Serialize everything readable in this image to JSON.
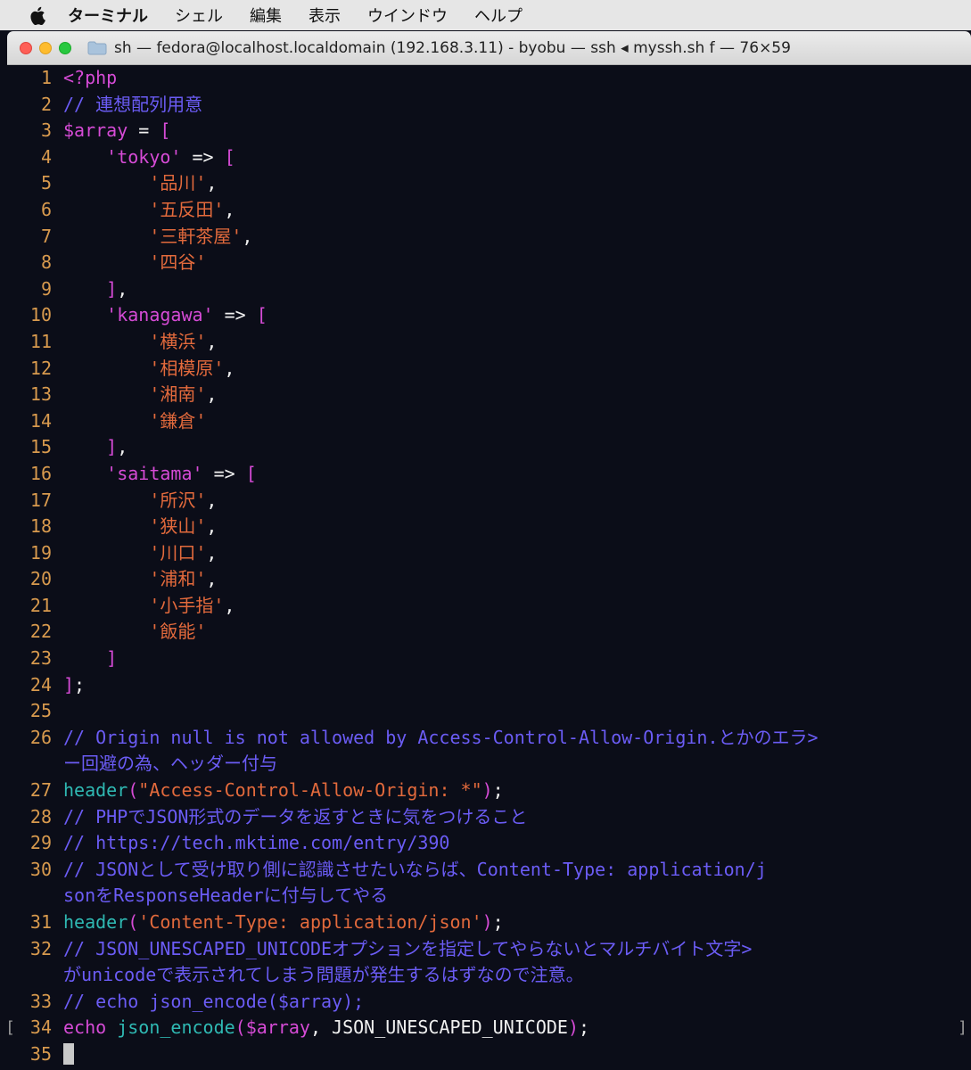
{
  "menubar": {
    "items": [
      "ターミナル",
      "シェル",
      "編集",
      "表示",
      "ウインドウ",
      "ヘルプ"
    ]
  },
  "window": {
    "title": "sh — fedora@localhost.localdomain (192.168.3.11) - byobu — ssh ◂ myssh.sh f — 76×59"
  },
  "colors": {
    "line_number": "#d89a4e",
    "keyword": "#d64bd6",
    "comment": "#6b5cf5",
    "string": "#e36a3c",
    "plain": "#f0f0f0",
    "function": "#2fb9b3",
    "background": "#0b0d18"
  },
  "code_lines": [
    {
      "n": "1",
      "tokens": [
        {
          "t": "<?php",
          "c": "magenta"
        }
      ]
    },
    {
      "n": "2",
      "tokens": [
        {
          "t": "// 連想配列用意",
          "c": "comment"
        }
      ]
    },
    {
      "n": "3",
      "tokens": [
        {
          "t": "$array",
          "c": "magenta"
        },
        {
          "t": " = ",
          "c": "white"
        },
        {
          "t": "[",
          "c": "magenta"
        }
      ]
    },
    {
      "n": "4",
      "tokens": [
        {
          "t": "    ",
          "c": "white"
        },
        {
          "t": "'tokyo'",
          "c": "magenta"
        },
        {
          "t": " => ",
          "c": "white"
        },
        {
          "t": "[",
          "c": "magenta"
        }
      ]
    },
    {
      "n": "5",
      "tokens": [
        {
          "t": "        ",
          "c": "white"
        },
        {
          "t": "'品川'",
          "c": "string"
        },
        {
          "t": ",",
          "c": "white"
        }
      ]
    },
    {
      "n": "6",
      "tokens": [
        {
          "t": "        ",
          "c": "white"
        },
        {
          "t": "'五反田'",
          "c": "string"
        },
        {
          "t": ",",
          "c": "white"
        }
      ]
    },
    {
      "n": "7",
      "tokens": [
        {
          "t": "        ",
          "c": "white"
        },
        {
          "t": "'三軒茶屋'",
          "c": "string"
        },
        {
          "t": ",",
          "c": "white"
        }
      ]
    },
    {
      "n": "8",
      "tokens": [
        {
          "t": "        ",
          "c": "white"
        },
        {
          "t": "'四谷'",
          "c": "string"
        }
      ]
    },
    {
      "n": "9",
      "tokens": [
        {
          "t": "    ",
          "c": "white"
        },
        {
          "t": "]",
          "c": "magenta"
        },
        {
          "t": ",",
          "c": "white"
        }
      ]
    },
    {
      "n": "10",
      "tokens": [
        {
          "t": "    ",
          "c": "white"
        },
        {
          "t": "'kanagawa'",
          "c": "magenta"
        },
        {
          "t": " => ",
          "c": "white"
        },
        {
          "t": "[",
          "c": "magenta"
        }
      ]
    },
    {
      "n": "11",
      "tokens": [
        {
          "t": "        ",
          "c": "white"
        },
        {
          "t": "'横浜'",
          "c": "string"
        },
        {
          "t": ",",
          "c": "white"
        }
      ]
    },
    {
      "n": "12",
      "tokens": [
        {
          "t": "        ",
          "c": "white"
        },
        {
          "t": "'相模原'",
          "c": "string"
        },
        {
          "t": ",",
          "c": "white"
        }
      ]
    },
    {
      "n": "13",
      "tokens": [
        {
          "t": "        ",
          "c": "white"
        },
        {
          "t": "'湘南'",
          "c": "string"
        },
        {
          "t": ",",
          "c": "white"
        }
      ]
    },
    {
      "n": "14",
      "tokens": [
        {
          "t": "        ",
          "c": "white"
        },
        {
          "t": "'鎌倉'",
          "c": "string"
        }
      ]
    },
    {
      "n": "15",
      "tokens": [
        {
          "t": "    ",
          "c": "white"
        },
        {
          "t": "]",
          "c": "magenta"
        },
        {
          "t": ",",
          "c": "white"
        }
      ]
    },
    {
      "n": "16",
      "tokens": [
        {
          "t": "    ",
          "c": "white"
        },
        {
          "t": "'saitama'",
          "c": "magenta"
        },
        {
          "t": " => ",
          "c": "white"
        },
        {
          "t": "[",
          "c": "magenta"
        }
      ]
    },
    {
      "n": "17",
      "tokens": [
        {
          "t": "        ",
          "c": "white"
        },
        {
          "t": "'所沢'",
          "c": "string"
        },
        {
          "t": ",",
          "c": "white"
        }
      ]
    },
    {
      "n": "18",
      "tokens": [
        {
          "t": "        ",
          "c": "white"
        },
        {
          "t": "'狭山'",
          "c": "string"
        },
        {
          "t": ",",
          "c": "white"
        }
      ]
    },
    {
      "n": "19",
      "tokens": [
        {
          "t": "        ",
          "c": "white"
        },
        {
          "t": "'川口'",
          "c": "string"
        },
        {
          "t": ",",
          "c": "white"
        }
      ]
    },
    {
      "n": "20",
      "tokens": [
        {
          "t": "        ",
          "c": "white"
        },
        {
          "t": "'浦和'",
          "c": "string"
        },
        {
          "t": ",",
          "c": "white"
        }
      ]
    },
    {
      "n": "21",
      "tokens": [
        {
          "t": "        ",
          "c": "white"
        },
        {
          "t": "'小手指'",
          "c": "string"
        },
        {
          "t": ",",
          "c": "white"
        }
      ]
    },
    {
      "n": "22",
      "tokens": [
        {
          "t": "        ",
          "c": "white"
        },
        {
          "t": "'飯能'",
          "c": "string"
        }
      ]
    },
    {
      "n": "23",
      "tokens": [
        {
          "t": "    ",
          "c": "white"
        },
        {
          "t": "]",
          "c": "magenta"
        }
      ]
    },
    {
      "n": "24",
      "tokens": [
        {
          "t": "]",
          "c": "magenta"
        },
        {
          "t": ";",
          "c": "white"
        }
      ]
    },
    {
      "n": "25",
      "tokens": []
    },
    {
      "n": "26",
      "tokens": [
        {
          "t": "// Origin null is not allowed by Access-Control-Allow-Origin.とかのエラ>",
          "c": "comment"
        }
      ]
    },
    {
      "n": "",
      "tokens": [
        {
          "t": "ー回避の為、ヘッダー付与",
          "c": "comment"
        }
      ]
    },
    {
      "n": "27",
      "tokens": [
        {
          "t": "header",
          "c": "teal"
        },
        {
          "t": "(",
          "c": "magenta"
        },
        {
          "t": "\"Access-Control-Allow-Origin: *\"",
          "c": "string"
        },
        {
          "t": ")",
          "c": "magenta"
        },
        {
          "t": ";",
          "c": "white"
        }
      ]
    },
    {
      "n": "28",
      "tokens": [
        {
          "t": "// PHPでJSON形式のデータを返すときに気をつけること",
          "c": "comment"
        }
      ]
    },
    {
      "n": "29",
      "tokens": [
        {
          "t": "// https://tech.mktime.com/entry/390",
          "c": "comment"
        }
      ]
    },
    {
      "n": "30",
      "tokens": [
        {
          "t": "// JSONとして受け取り側に認識させたいならば、Content-Type: application/j",
          "c": "comment"
        }
      ]
    },
    {
      "n": "",
      "tokens": [
        {
          "t": "sonをResponseHeaderに付与してやる",
          "c": "comment"
        }
      ]
    },
    {
      "n": "31",
      "tokens": [
        {
          "t": "header",
          "c": "teal"
        },
        {
          "t": "(",
          "c": "magenta"
        },
        {
          "t": "'Content-Type: application/json'",
          "c": "string"
        },
        {
          "t": ")",
          "c": "magenta"
        },
        {
          "t": ";",
          "c": "white"
        }
      ]
    },
    {
      "n": "32",
      "tokens": [
        {
          "t": "// JSON_UNESCAPED_UNICODEオプションを指定してやらないとマルチバイト文字>",
          "c": "comment"
        }
      ]
    },
    {
      "n": "",
      "tokens": [
        {
          "t": "がunicodeで表示されてしまう問題が発生するはずなので注意。",
          "c": "comment"
        }
      ]
    },
    {
      "n": "33",
      "tokens": [
        {
          "t": "// echo json_encode($array);",
          "c": "comment"
        }
      ]
    },
    {
      "n": "34",
      "tokens": [
        {
          "t": "echo",
          "c": "magenta"
        },
        {
          "t": " ",
          "c": "white"
        },
        {
          "t": "json_encode",
          "c": "teal"
        },
        {
          "t": "(",
          "c": "magenta"
        },
        {
          "t": "$array",
          "c": "magenta"
        },
        {
          "t": ", JSON_UNESCAPED_UNICODE",
          "c": "white"
        },
        {
          "t": ")",
          "c": "magenta"
        },
        {
          "t": ";",
          "c": "white"
        }
      ]
    },
    {
      "n": "35",
      "tokens": [
        {
          "t": " ",
          "c": "cursor"
        }
      ]
    }
  ],
  "brackets": {
    "left": "[",
    "right": "]"
  }
}
